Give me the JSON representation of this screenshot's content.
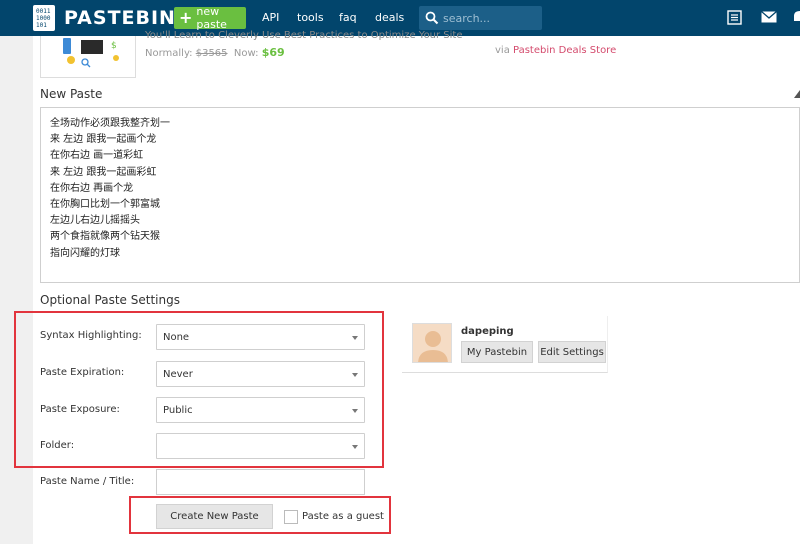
{
  "header": {
    "logo_text": "PASTEBIN",
    "new_paste_label": "new paste",
    "nav": [
      "API",
      "tools",
      "faq",
      "deals"
    ],
    "search_placeholder": "search...",
    "icons": [
      "list-icon",
      "mail-icon",
      "bell-icon"
    ]
  },
  "promo": {
    "title": "You'll Learn to Cleverly Use Best Practices to Optimize Your Site",
    "normally_label": "Normally:",
    "old_price": "$3565",
    "now_label": "Now:",
    "now_price": "$69",
    "via_label": "via",
    "store_name": "Pastebin Deals Store"
  },
  "new_paste": {
    "heading": "New Paste",
    "lines": [
      "全场动作必须跟我整齐划一",
      "来 左边 跟我一起画个龙",
      "在你右边 画一道彩虹",
      "来 左边 跟我一起画彩虹",
      "在你右边 再画个龙",
      "在你胸口比划一个郭富城",
      "左边儿右边儿摇摇头",
      "两个食指就像两个钻天猴",
      "指向闪耀的灯球"
    ]
  },
  "settings": {
    "heading": "Optional Paste Settings",
    "syntax_label": "Syntax Highlighting:",
    "syntax_value": "None",
    "expiration_label": "Paste Expiration:",
    "expiration_value": "Never",
    "exposure_label": "Paste Exposure:",
    "exposure_value": "Public",
    "folder_label": "Folder:",
    "folder_value": "",
    "name_label": "Paste Name / Title:",
    "name_value": ""
  },
  "actions": {
    "create_label": "Create New Paste",
    "guest_label": "Paste as a guest"
  },
  "user": {
    "username": "dapeping",
    "my_pastebin_label": "My Pastebin",
    "edit_settings_label": "Edit Settings"
  },
  "colors": {
    "header_bg": "#02456c",
    "accent_green": "#6abf40",
    "highlight_red": "#e2343d",
    "store_pink": "#d44b6d"
  }
}
